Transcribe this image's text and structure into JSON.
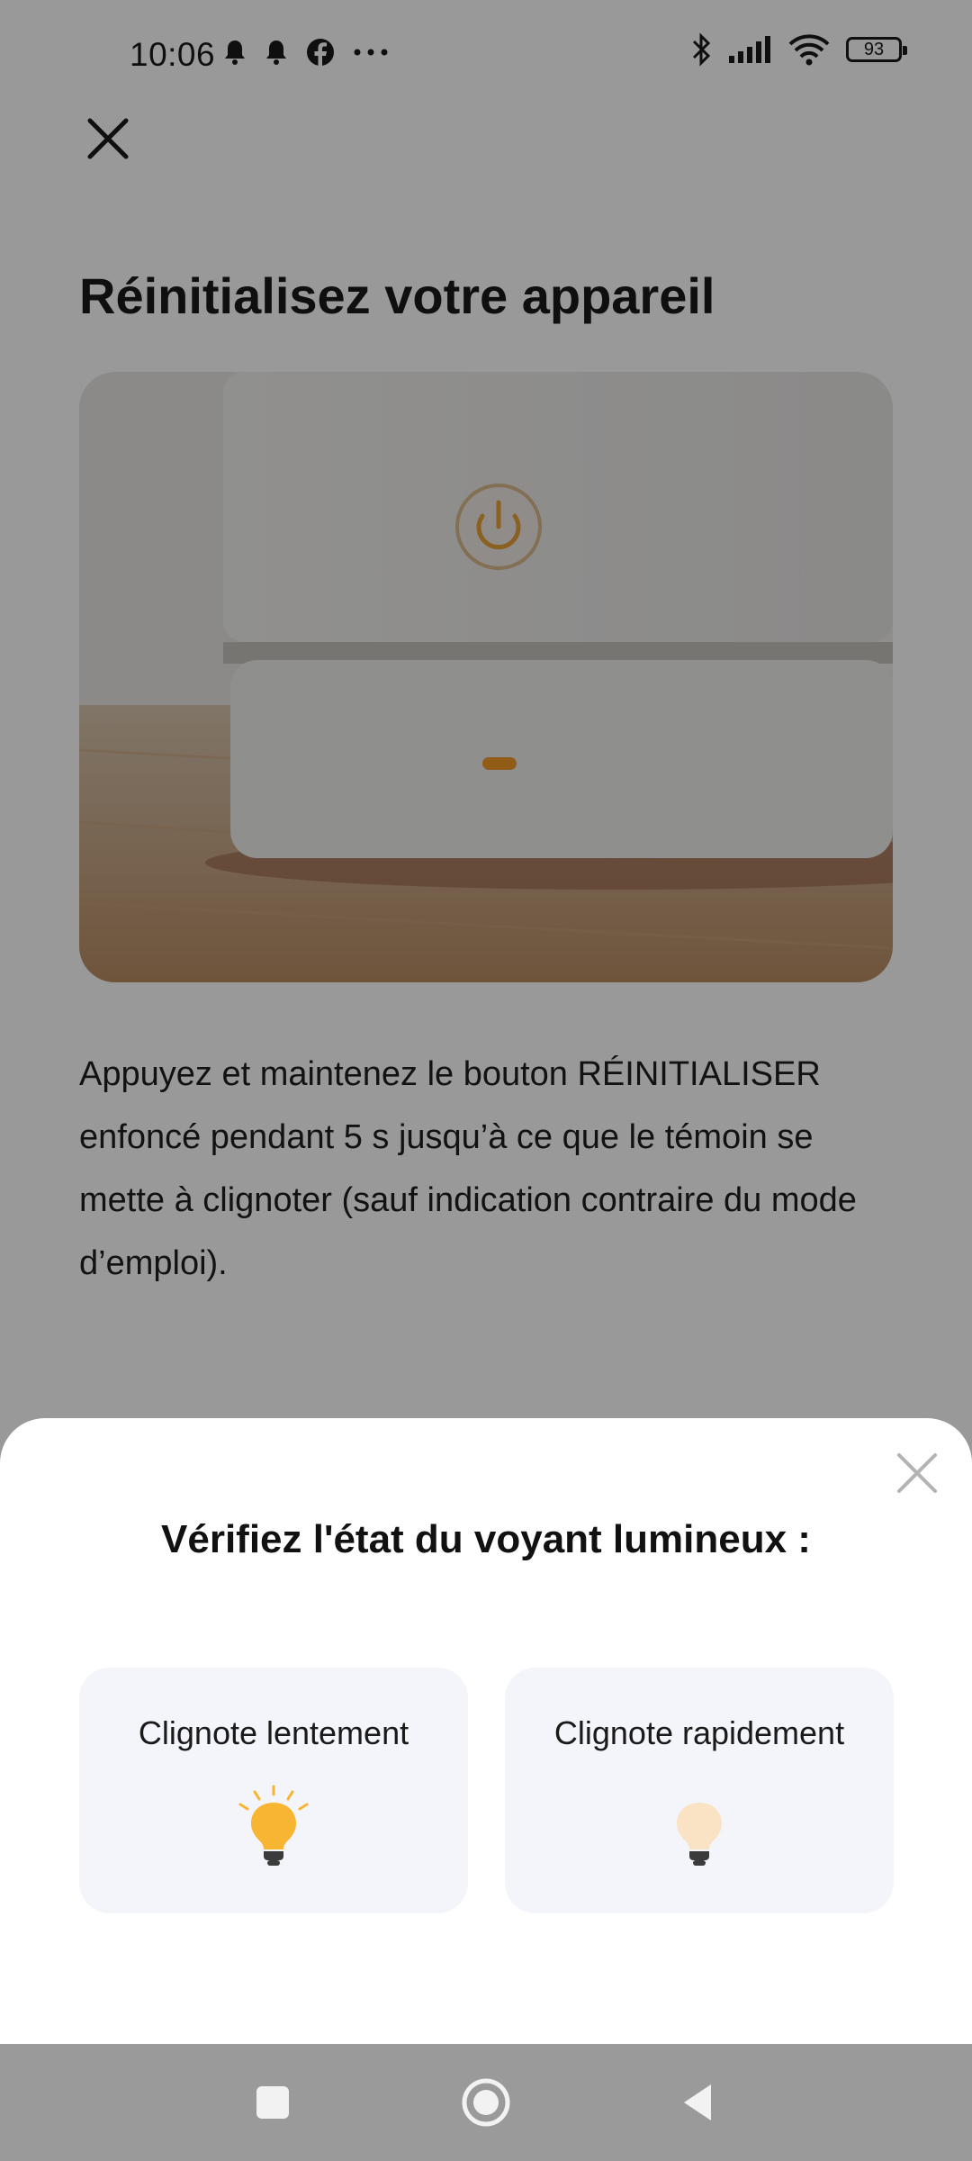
{
  "status_bar": {
    "time": "10:06",
    "battery": "93",
    "left_icons": [
      "bell-icon",
      "bell-icon",
      "facebook-icon",
      "more-dots-icon"
    ],
    "right_icons": [
      "bluetooth-icon",
      "signal-icon",
      "wifi-icon",
      "battery-icon"
    ]
  },
  "header": {
    "title": "Réinitialisez votre appareil"
  },
  "main": {
    "instructions": "Appuyez et maintenez le bouton RÉINITIALISER enfoncé pendant 5 s jusqu’à ce que le témoin se mette à clignoter (sauf indication contraire du mode d’emploi)."
  },
  "sheet": {
    "title": "Vérifiez l'état du voyant lumineux :",
    "options": [
      {
        "label": "Clignote lentement",
        "icon": "bulb-bright-icon"
      },
      {
        "label": "Clignote rapidement",
        "icon": "bulb-dim-icon"
      }
    ]
  },
  "nav_bar": {
    "buttons": [
      "recents-square-icon",
      "home-circle-icon",
      "back-triangle-icon"
    ]
  },
  "colors": {
    "overlay": "#000000",
    "bulb_bright": "#f7b531",
    "bulb_dim": "#f9e3c4",
    "card_bg": "#f4f5fa"
  }
}
